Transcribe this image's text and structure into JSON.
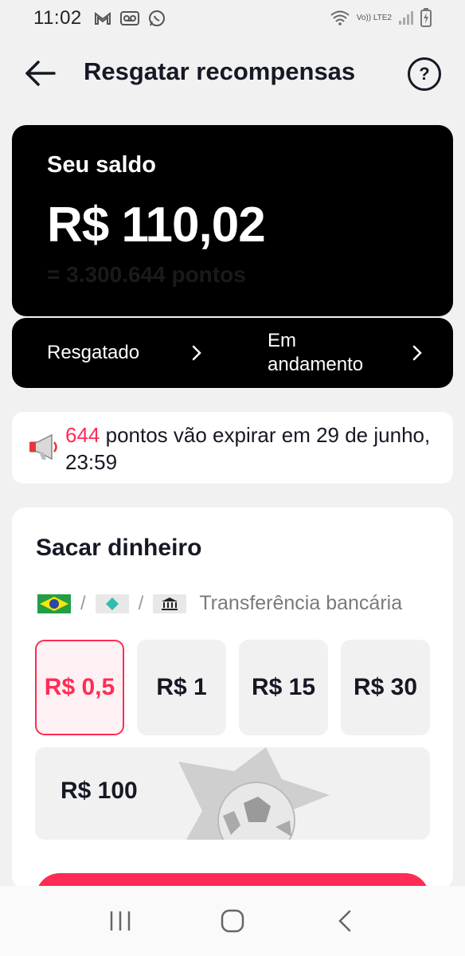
{
  "status_bar": {
    "time": "11:02",
    "icons_left": [
      "gmail-icon",
      "voicemail-icon",
      "whatsapp-icon"
    ],
    "network_label": "Vo)) LTE2",
    "icons_right": [
      "wifi-icon",
      "signal-icon",
      "battery-icon"
    ]
  },
  "header": {
    "title": "Resgatar recompensas",
    "back_icon": "arrow-left-icon",
    "help_label": "?"
  },
  "balance": {
    "label": "Seu saldo",
    "value": "R$ 110,02",
    "points": "= 3.300.644 pontos"
  },
  "links": {
    "redeemed": "Resgatado",
    "in_progress": "Em andamento"
  },
  "expiry": {
    "points": "644",
    "text": " pontos vão expirar em 29 de junho, 23:59"
  },
  "cash": {
    "title": "Sacar dinheiro",
    "methods": [
      "brazil-flag-icon",
      "pix-icon",
      "bank-icon"
    ],
    "separator": "/",
    "bank_label": "Transferência bancária",
    "amounts": [
      "R$ 0,5",
      "R$ 1",
      "R$ 15",
      "R$ 30"
    ],
    "selected_index": 0,
    "wide_amount": "R$ 100"
  },
  "colors": {
    "accent": "#fe2c55",
    "card_dark": "#000000",
    "background": "#f1f1f2"
  },
  "nav": [
    "recent-apps-icon",
    "home-icon",
    "back-icon"
  ]
}
